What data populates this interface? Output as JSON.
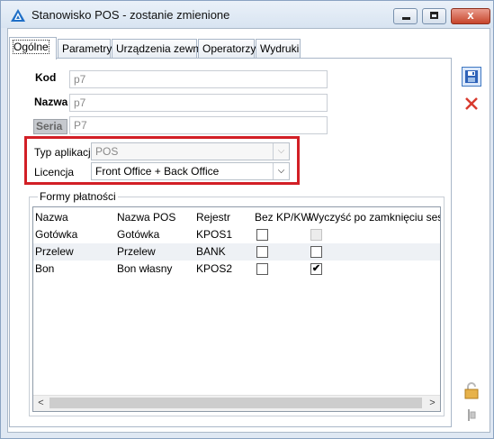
{
  "window": {
    "title": "Stanowisko POS - zostanie zmienione",
    "buttons": {
      "minimize": "minimize",
      "maximize": "maximize",
      "close": "x"
    }
  },
  "tabs": [
    {
      "label": "Ogólne",
      "active": true
    },
    {
      "label": "Parametry"
    },
    {
      "label": "Urządzenia zewn."
    },
    {
      "label": "Operatorzy"
    },
    {
      "label": "Wydruki"
    }
  ],
  "form": {
    "kod": {
      "label": "Kod",
      "value": "p7"
    },
    "nazwa": {
      "label": "Nazwa",
      "value": "p7"
    },
    "seria": {
      "label": "Seria",
      "value": "P7"
    },
    "typ_aplikacji": {
      "label": "Typ aplikacji",
      "value": "POS",
      "disabled": true
    },
    "licencja": {
      "label": "Licencja",
      "value": "Front Office + Back Office"
    }
  },
  "payments": {
    "group_title": "Formy płatności",
    "columns": [
      "Nazwa",
      "Nazwa POS",
      "Rejestr",
      "Bez KP/KW",
      "Wyczyść po zamknięciu sesji"
    ],
    "rows": [
      {
        "nazwa": "Gotówka",
        "nazwa_pos": "Gotówka",
        "rejestr": "KPOS1",
        "bez_kp_kw": false,
        "wyczysc": false,
        "wyczysc_disabled": true
      },
      {
        "nazwa": "Przelew",
        "nazwa_pos": "Przelew",
        "rejestr": "BANK",
        "bez_kp_kw": false,
        "wyczysc": false
      },
      {
        "nazwa": "Bon",
        "nazwa_pos": "Bon własny",
        "rejestr": "KPOS2",
        "bez_kp_kw": false,
        "wyczysc": true
      }
    ],
    "check_mark": "✔"
  },
  "side_icons": [
    "save-icon",
    "cancel-icon",
    "lock-icon",
    "filter-icon"
  ],
  "colors": {
    "highlight": "#d21f26",
    "save_border": "#3f78c2",
    "cancel": "#d83a2e"
  },
  "glyphs": {
    "combo_arrow": "⌵",
    "scroll_left": "<",
    "scroll_right": ">"
  }
}
